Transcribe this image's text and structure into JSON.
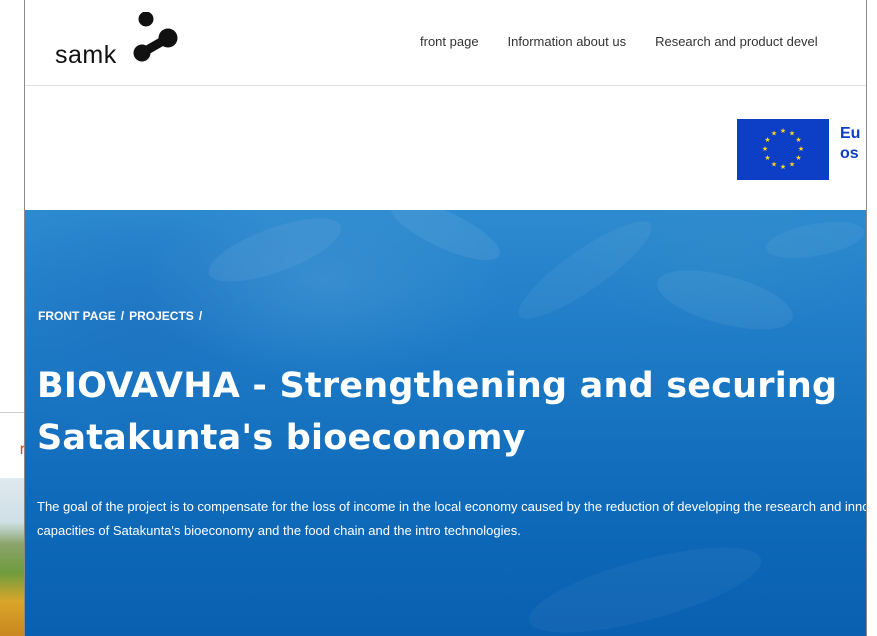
{
  "background_window": {
    "fragment_text": "rm"
  },
  "header": {
    "logo_text": "samk",
    "nav": [
      {
        "label": "front page"
      },
      {
        "label": "Information about us"
      },
      {
        "label": "Research and product devel"
      }
    ]
  },
  "eu_banner": {
    "text_line1": "Eu",
    "text_line2": "os"
  },
  "hero": {
    "breadcrumb": [
      "FRONT PAGE",
      "PROJECTS"
    ],
    "breadcrumb_separator": "/",
    "title": "BIOVAVHA - Strengthening and securing Satakunta's bioeconomy",
    "description": "The goal of the project is to compensate for the loss of income in the local economy caused by the reduction of developing the research and innovation capacities of Satakunta's bioeconomy and the food chain and the intro technologies."
  },
  "colors": {
    "eu_blue": "#0c3ec6",
    "eu_star": "#ffd617",
    "hero_blue": "#1c79c5",
    "fragment_orange": "#c8501e"
  }
}
